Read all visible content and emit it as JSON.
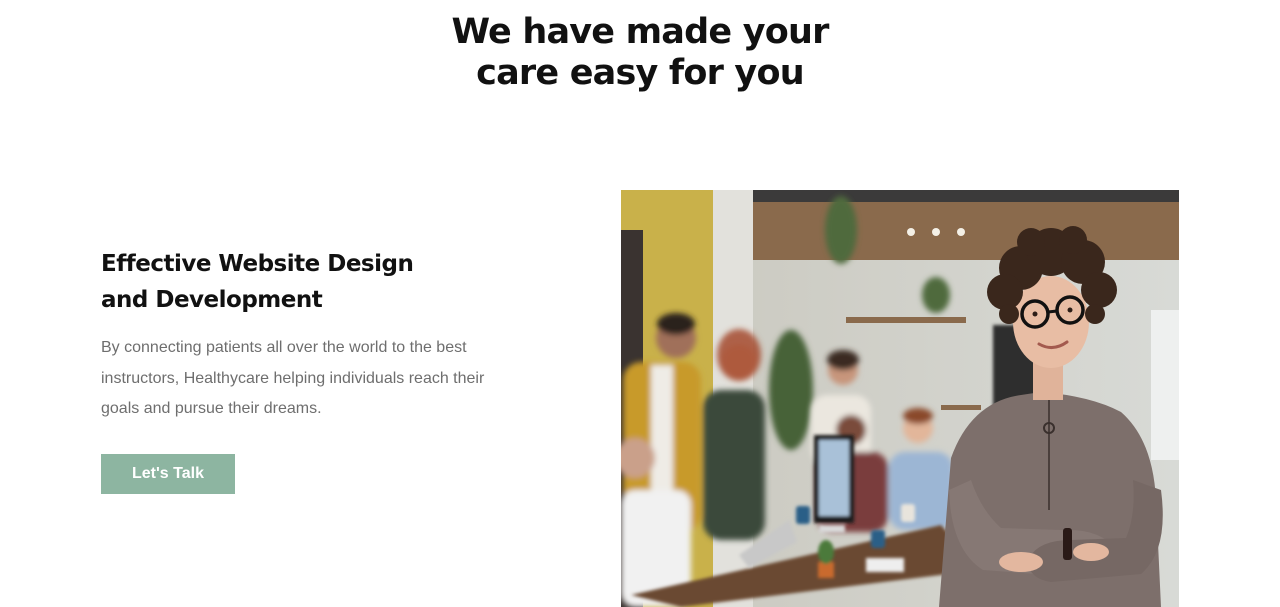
{
  "hero": {
    "title_line1": "We have made your",
    "title_line2": "care easy for you"
  },
  "feature": {
    "title_line1": "Effective Website Design",
    "title_line2": "and Development",
    "description": "By connecting patients all over the world to the best instructors, Healthycare helping individuals reach their goals and pursue their dreams.",
    "cta_label": "Let's Talk"
  },
  "colors": {
    "cta": "#8db5a1",
    "heading": "#111111",
    "body_text": "#6e6e6e"
  },
  "image": {
    "subject": "office-team-photo"
  }
}
